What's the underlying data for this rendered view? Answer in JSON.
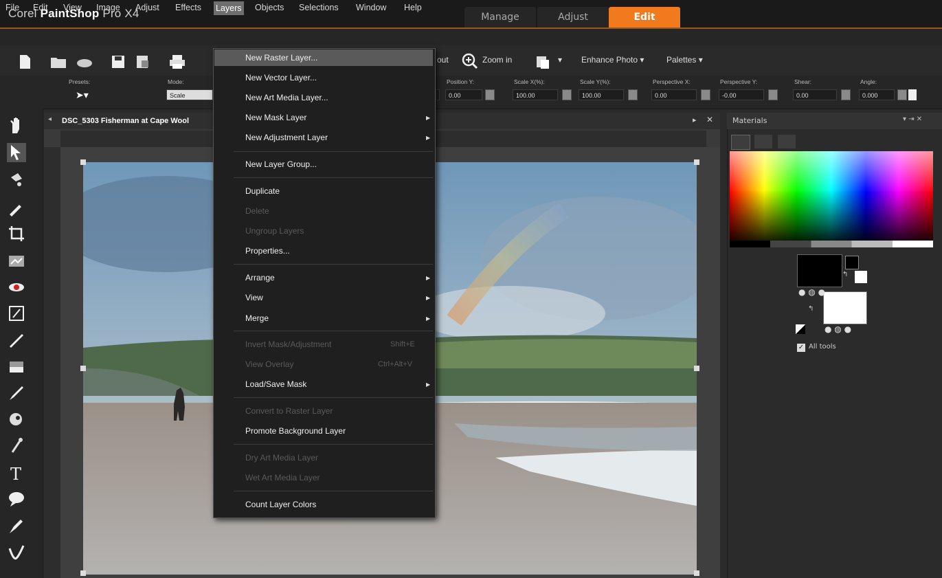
{
  "app": {
    "title_light": "Corel",
    "title_bold": "PaintShop",
    "title_version": "Pro X4"
  },
  "mode_tabs": [
    {
      "label": "Manage",
      "active": false
    },
    {
      "label": "Adjust",
      "active": false
    },
    {
      "label": "Edit",
      "active": true
    }
  ],
  "menubar": [
    "File",
    "Edit",
    "View",
    "Image",
    "Adjust",
    "Effects",
    "Layers",
    "Objects",
    "Selections",
    "Window",
    "Help"
  ],
  "open_menu": "Layers",
  "toolbar": {
    "zoom_out_partial": "out",
    "zoom_in": "Zoom in",
    "enhance_photo": "Enhance Photo",
    "palettes": "Palettes"
  },
  "options": {
    "presets_label": "Presets:",
    "mode_label": "Mode:",
    "mode_value": "Scale",
    "position_y_label": "Position Y:",
    "position_y": "0.00",
    "scale_x_label": "Scale X(%):",
    "scale_x": "100.00",
    "scale_y_label": "Scale Y(%):",
    "scale_y": "100.00",
    "persp_x_label": "Perspective X:",
    "persp_x": "0.00",
    "persp_y_label": "Perspective Y:",
    "persp_y": "-0.00",
    "shear_label": "Shear:",
    "shear": "0.00",
    "angle_label": "Angle:",
    "angle": "0.000",
    "left_partial_value": "0.00"
  },
  "document": {
    "title": "DSC_5303 Fisherman at Cape Wool"
  },
  "materials": {
    "title": "Materials",
    "all_tools": "All tools"
  },
  "dropdown": [
    {
      "label": "New Raster Layer...",
      "enabled": true,
      "highlighted": true
    },
    {
      "label": "New Vector Layer...",
      "enabled": true
    },
    {
      "label": "New Art Media Layer...",
      "enabled": true
    },
    {
      "label": "New Mask Layer",
      "enabled": true,
      "submenu": true
    },
    {
      "label": "New Adjustment Layer",
      "enabled": true,
      "submenu": true
    },
    {
      "label": "New Layer Group...",
      "enabled": true
    },
    {
      "label": "Duplicate",
      "enabled": true
    },
    {
      "label": "Delete",
      "enabled": false
    },
    {
      "label": "Ungroup Layers",
      "enabled": false
    },
    {
      "label": "Properties...",
      "enabled": true
    },
    {
      "label": "Arrange",
      "enabled": true,
      "submenu": true
    },
    {
      "label": "View",
      "enabled": true,
      "submenu": true
    },
    {
      "label": "Merge",
      "enabled": true,
      "submenu": true
    },
    {
      "label": "Invert Mask/Adjustment",
      "enabled": false,
      "shortcut": "Shift+E"
    },
    {
      "label": "View Overlay",
      "enabled": false,
      "shortcut": "Ctrl+Alt+V"
    },
    {
      "label": "Load/Save Mask",
      "enabled": true,
      "submenu": true
    },
    {
      "label": "Convert to Raster Layer",
      "enabled": false
    },
    {
      "label": "Promote Background Layer",
      "enabled": true
    },
    {
      "label": "Dry Art Media Layer",
      "enabled": false
    },
    {
      "label": "Wet Art Media Layer",
      "enabled": false
    },
    {
      "label": "Count Layer Colors",
      "enabled": true
    }
  ],
  "colors": {
    "accent": "#f07a1c",
    "menu_bg": "#1f1f1f",
    "highlight": "#5a5a5a"
  }
}
